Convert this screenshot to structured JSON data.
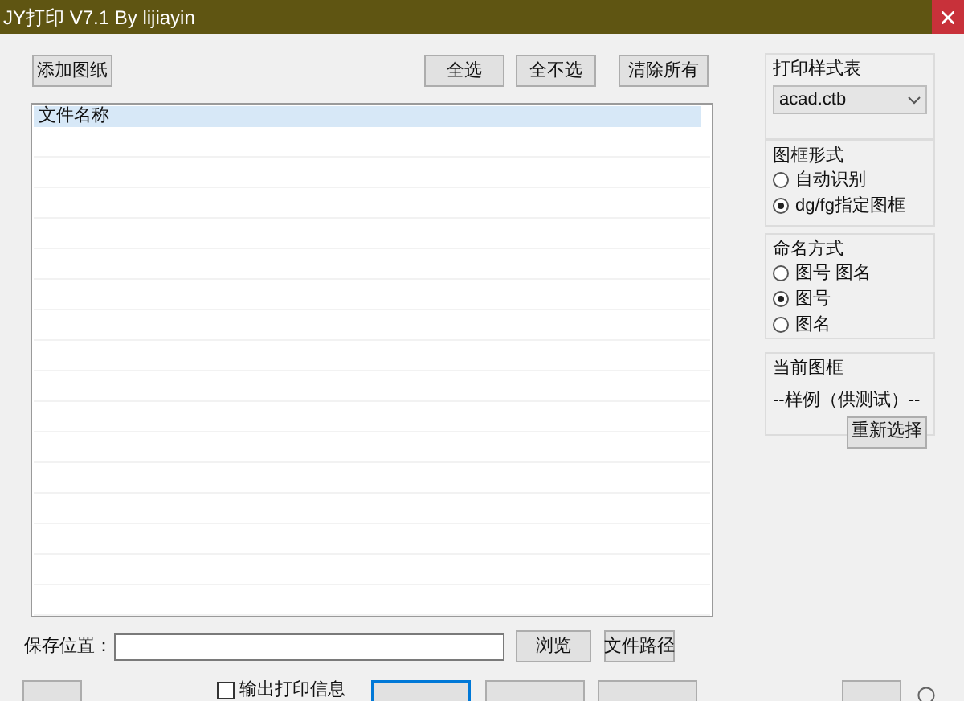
{
  "window": {
    "title": "JY打印 V7.1 By lijiayin"
  },
  "toolbar": {
    "add_button": "添加图纸",
    "buttons": [
      "全选",
      "全不选",
      "清除所有"
    ]
  },
  "file_list": {
    "header": "文件名称",
    "header_selected": true
  },
  "print_style": {
    "title": "打印样式表",
    "value": "acad.ctb"
  },
  "frame_mode": {
    "title": "图框形式",
    "options": [
      {
        "label": "自动识别",
        "selected": false
      },
      {
        "label": "dg/fg指定图框",
        "selected": true
      }
    ]
  },
  "naming": {
    "title": "命名方式",
    "options": [
      {
        "label": "图号 图名",
        "selected": false
      },
      {
        "label": "图号",
        "selected": true
      },
      {
        "label": "图名",
        "selected": false
      }
    ]
  },
  "current_frame": {
    "title": "当前图框",
    "value": "--样例（供测试）--",
    "button": "重新选择"
  },
  "save": {
    "label": "保存位置：",
    "buttons": [
      "浏览",
      "文件路径"
    ]
  },
  "bottom": {
    "checkbox": {
      "label": "输出打印信息",
      "checked": false
    }
  }
}
